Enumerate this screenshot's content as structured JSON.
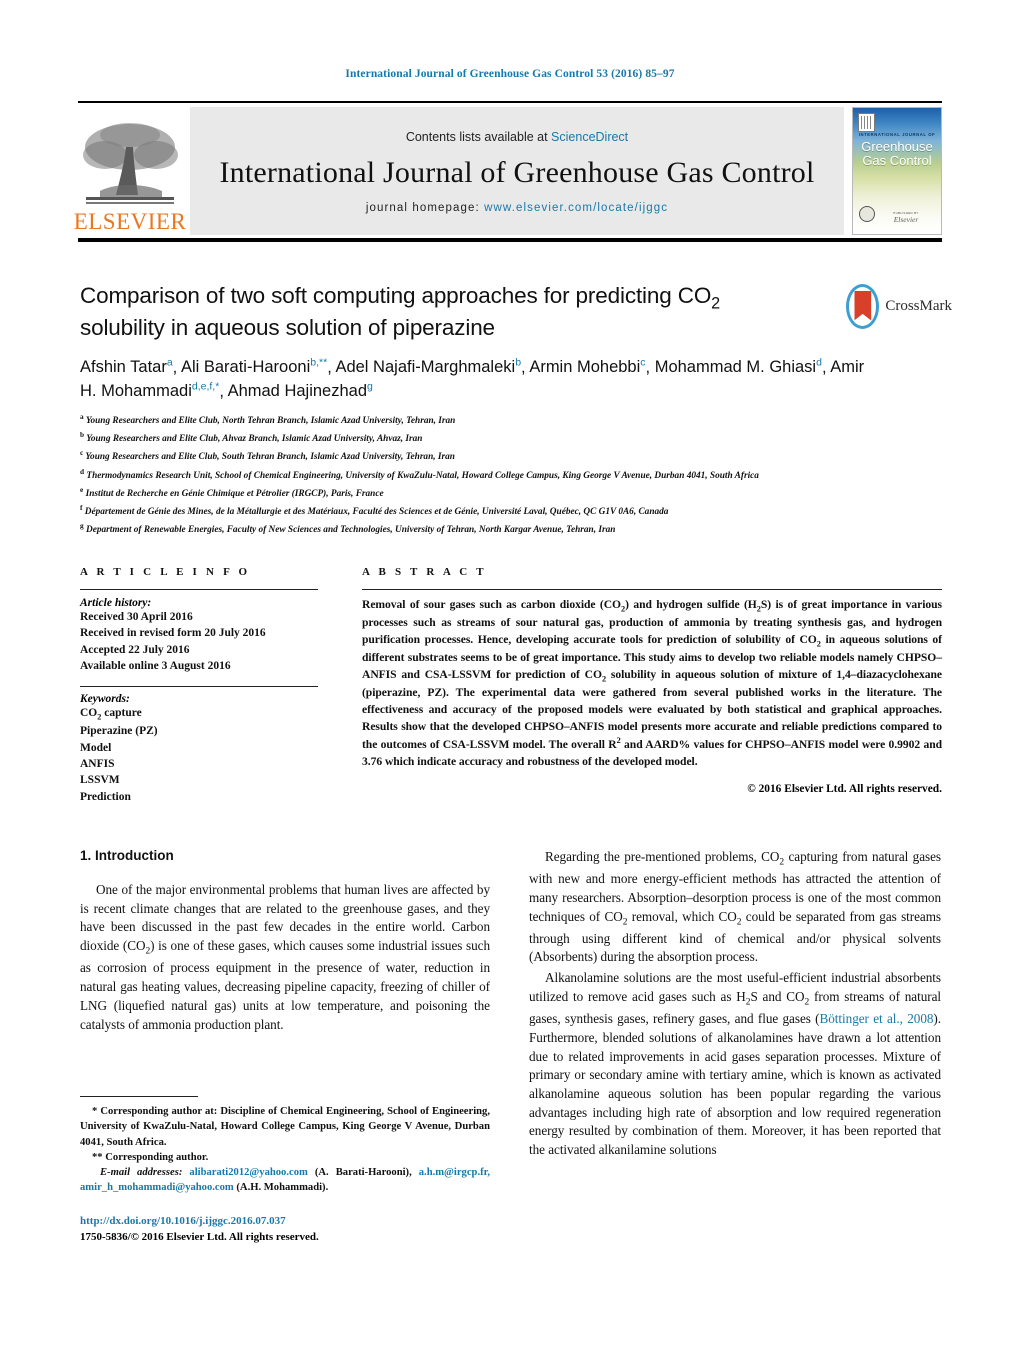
{
  "running_head": "International Journal of Greenhouse Gas Control 53 (2016) 85–97",
  "masthead": {
    "publisher_logo_label": "ELSEVIER",
    "contents_prefix": "Contents lists available at ",
    "contents_link": "ScienceDirect",
    "journal_title": "International Journal of Greenhouse Gas Control",
    "homepage_prefix": "journal homepage: ",
    "homepage_url": "www.elsevier.com/locate/ijggc",
    "cover": {
      "kicker": "INTERNATIONAL JOURNAL OF",
      "line1": "Greenhouse",
      "line2": "Gas Control",
      "publisher_small": "PUBLISHED BY",
      "publisher_name": "Elsevier"
    }
  },
  "article": {
    "title_line1": "Comparison of two soft computing approaches for predicting CO",
    "title_sub1": "2",
    "title_line2": "solubility in aqueous solution of piperazine",
    "authors_line1": "Afshin Tatar",
    "authors": [
      {
        "name": "Afshin Tatar",
        "marks": "a"
      },
      {
        "name": "Ali Barati-Harooni",
        "marks": "b,**"
      },
      {
        "name": "Adel Najafi-Marghmaleki",
        "marks": "b"
      },
      {
        "name": "Armin Mohebbi",
        "marks": "c"
      },
      {
        "name": "Mohammad M. Ghiasi",
        "marks": "d"
      },
      {
        "name": "Amir H. Mohammadi",
        "marks": "d,e,f,*"
      },
      {
        "name": "Ahmad Hajinezhad",
        "marks": "g"
      }
    ],
    "crossmark_label": "CrossMark",
    "affiliations": [
      {
        "mark": "a",
        "text": "Young Researchers and Elite Club, North Tehran Branch, Islamic Azad University, Tehran, Iran"
      },
      {
        "mark": "b",
        "text": "Young Researchers and Elite Club, Ahvaz Branch, Islamic Azad University, Ahvaz, Iran"
      },
      {
        "mark": "c",
        "text": "Young Researchers and Elite Club, South Tehran Branch, Islamic Azad University, Tehran, Iran"
      },
      {
        "mark": "d",
        "text": "Thermodynamics Research Unit, School of Chemical Engineering, University of KwaZulu-Natal, Howard College Campus, King George V Avenue, Durban 4041, South Africa"
      },
      {
        "mark": "e",
        "text": "Institut de Recherche en Génie Chimique et Pétrolier (IRGCP), Paris, France"
      },
      {
        "mark": "f",
        "text": "Département de Génie des Mines, de la Métallurgie et des Matériaux, Faculté des Sciences et de Génie, Université Laval, Québec, QC G1V 0A6, Canada"
      },
      {
        "mark": "g",
        "text": "Department of Renewable Energies, Faculty of New Sciences and Technologies, University of Tehran, North Kargar Avenue, Tehran, Iran"
      }
    ]
  },
  "article_info": {
    "heading": "A R T I C L E    I N F O",
    "history_label": "Article history:",
    "history": [
      "Received 30 April 2016",
      "Received in revised form 20 July 2016",
      "Accepted 22 July 2016",
      "Available online 3 August 2016"
    ],
    "keywords_label": "Keywords:",
    "keywords": [
      "CO2 capture",
      "Piperazine (PZ)",
      "Model",
      "ANFIS",
      "LSSVM",
      "Prediction"
    ]
  },
  "abstract": {
    "heading": "A B S T R A C T",
    "paragraph": "Removal of sour gases such as carbon dioxide (CO2) and hydrogen sulfide (H2S) is of great importance in various processes such as streams of sour natural gas, production of ammonia by treating synthesis gas, and hydrogen purification processes. Hence, developing accurate tools for prediction of solubility of CO2 in aqueous solutions of different substrates seems to be of great importance. This study aims to develop two reliable models namely CHPSO–ANFIS and CSA-LSSVM for prediction of CO2 solubility in aqueous solution of mixture of 1,4–diazacyclohexane (piperazine, PZ). The experimental data were gathered from several published works in the literature. The effectiveness and accuracy of the proposed models were evaluated by both statistical and graphical approaches. Results show that the developed CHPSO–ANFIS model presents more accurate and reliable predictions compared to the outcomes of CSA-LSSVM model. The overall R2 and AARD% values for CHPSO–ANFIS model were 0.9902 and 3.76 which indicate accuracy and robustness of the developed model.",
    "copyright": "© 2016 Elsevier Ltd. All rights reserved."
  },
  "body": {
    "section_number_title": "1.  Introduction",
    "left_paragraph": "One of the major environmental problems that human lives are affected by is recent climate changes that are related to the greenhouse gases, and they have been discussed in the past few decades in the entire world. Carbon dioxide (CO2) is one of these gases, which causes some industrial issues such as corrosion of process equipment in the presence of water, reduction in natural gas heating values, decreasing pipeline capacity, freezing of chiller of LNG (liquefied natural gas) units at low temperature, and poisoning the catalysts of ammonia production plant.",
    "right_paragraph_1": "Regarding the pre-mentioned problems, CO2 capturing from natural gases with new and more energy-efficient methods has attracted the attention of many researchers. Absorption–desorption process is one of the most common techniques of CO2 removal, which CO2 could be separated from gas streams through using different kind of chemical and/or physical solvents (Absorbents) during the absorption process.",
    "right_paragraph_2_a": "Alkanolamine solutions are the most useful-efficient industrial absorbents utilized to remove acid gases such as H2S and CO2 from streams of natural gases, synthesis gases, refinery gases, and flue gases (",
    "right_paragraph_2_cite": "Böttinger et al., 2008",
    "right_paragraph_2_b": "). Furthermore, blended solutions of alkanolamines have drawn a lot attention due to related improvements in acid gases separation processes. Mixture of primary or secondary amine with tertiary amine, which is known as activated alkanolamine aqueous solution has been popular regarding the various advantages including high rate of absorption and low required regeneration energy resulted by combination of them. Moreover, it has been reported that the activated alkanilamine solutions"
  },
  "footnotes": {
    "corresponding_1": "* Corresponding author at: Discipline of Chemical Engineering, School of Engineering, University of KwaZulu-Natal, Howard College Campus, King George V Avenue, Durban 4041, South Africa.",
    "corresponding_2": "** Corresponding author.",
    "email_label": "E-mail addresses:",
    "email_1": "alibarati2012@yahoo.com",
    "email_1_owner": "(A. Barati-Harooni),",
    "email_2": "a.h.m@irgcp.fr,",
    "email_3": "amir_h_mohammadi@yahoo.com",
    "email_3_owner": "(A.H. Mohammadi).",
    "doi": "http://dx.doi.org/10.1016/j.ijggc.2016.07.037",
    "issn_line": "1750-5836/© 2016 Elsevier Ltd. All rights reserved."
  },
  "colors": {
    "link_blue": "#1879a8",
    "elsevier_orange": "#E87722",
    "crossmark_blue": "#3b9fd4",
    "crossmark_red": "#d9402a"
  }
}
